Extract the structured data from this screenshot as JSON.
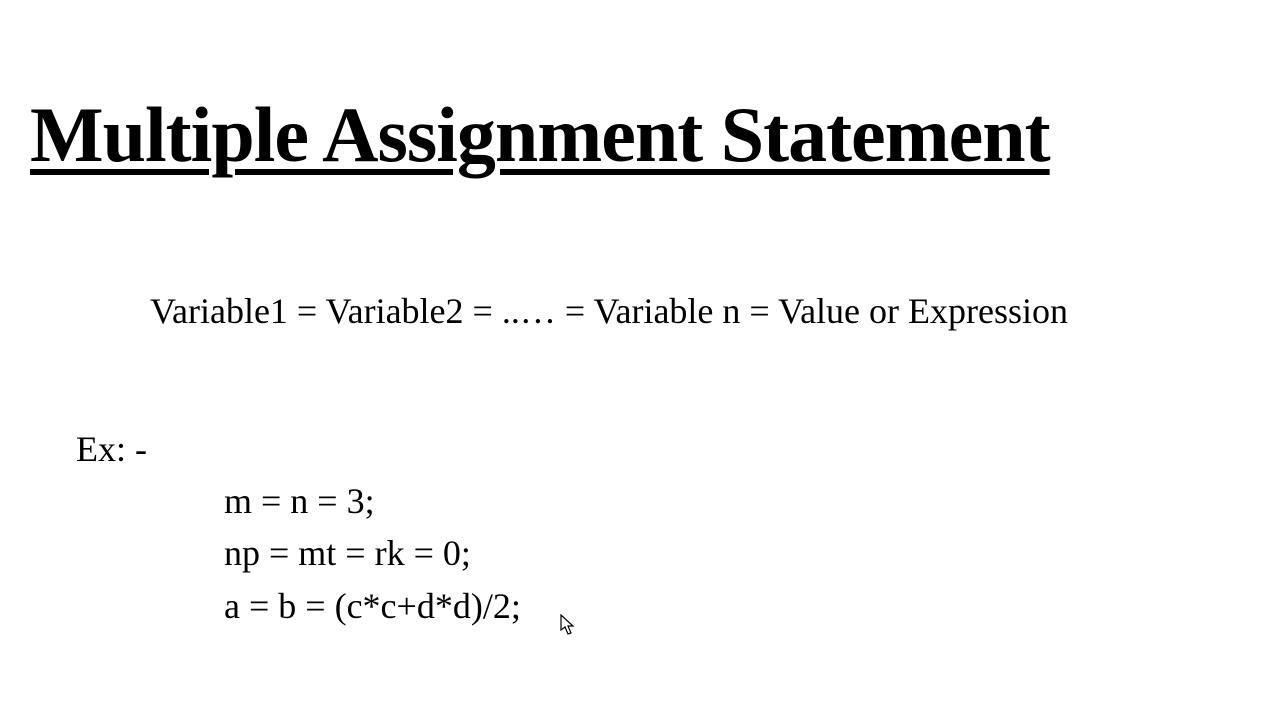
{
  "title": "Multiple Assignment Statement",
  "syntax": "Variable1 = Variable2 = ..… = Variable n = Value or Expression",
  "example_label": "Ex: -",
  "examples": {
    "line1": "m = n = 3;",
    "line2": "np = mt = rk = 0;",
    "line3": "a = b = (c*c+d*d)/2;"
  }
}
